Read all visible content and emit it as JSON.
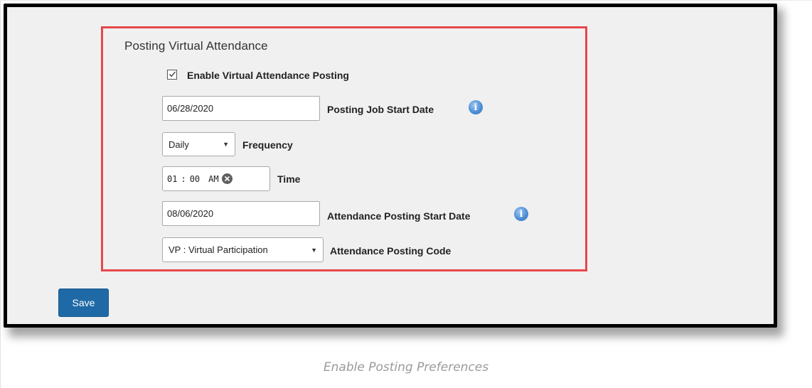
{
  "section": {
    "title": "Posting Virtual Attendance"
  },
  "enable_posting": {
    "checked": true,
    "label": "Enable Virtual Attendance Posting"
  },
  "posting_job_start_date": {
    "value": "06/28/2020",
    "label": "Posting Job Start Date",
    "info_icon": "info-icon"
  },
  "frequency": {
    "selected": "Daily",
    "label": "Frequency"
  },
  "time": {
    "hour": "01",
    "separator": ":",
    "minute": "00",
    "meridiem": "AM",
    "label": "Time"
  },
  "attendance_posting_start_date": {
    "value": "08/06/2020",
    "label": "Attendance Posting Start Date",
    "info_icon": "info-icon"
  },
  "attendance_posting_code": {
    "selected": "VP : Virtual Participation",
    "label": "Attendance Posting Code"
  },
  "actions": {
    "save_label": "Save"
  },
  "caption": "Enable Posting Preferences",
  "colors": {
    "highlight": "#e8474b",
    "save_button": "#1f6aa6",
    "panel_background": "#f0f0f0"
  }
}
